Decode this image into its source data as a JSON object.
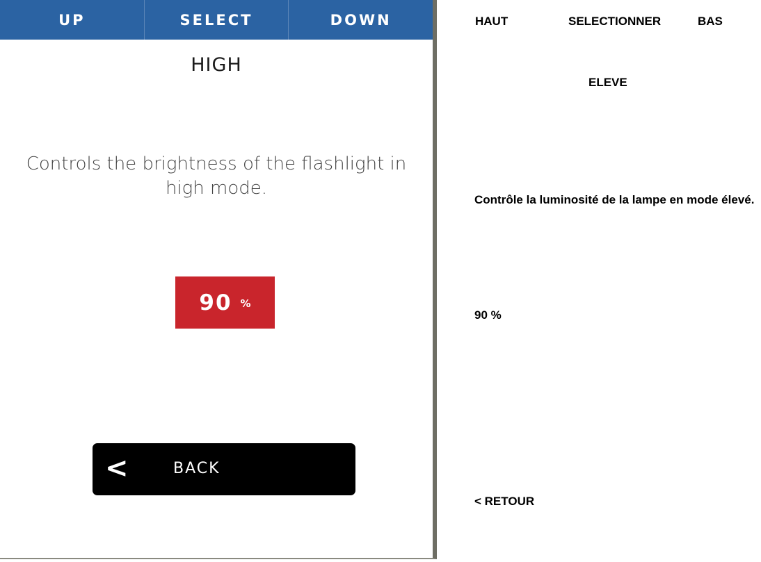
{
  "device": {
    "topbar": {
      "up_label": "UP",
      "select_label": "SELECT",
      "down_label": "DOWN"
    },
    "title": "HIGH",
    "description": "Controls the brightness of the flashlight in high mode.",
    "value": {
      "number": "90",
      "unit": "%"
    },
    "back": {
      "chevron": "<",
      "label": "BACK"
    }
  },
  "translation": {
    "up": "HAUT",
    "select": "SELECTIONNER",
    "down": "BAS",
    "title": "ELEVE",
    "description": "Contrôle la luminosité de la lampe en mode élevé.",
    "value": "90 %",
    "back": "< RETOUR"
  },
  "colors": {
    "topbar_blue": "#2b63a3",
    "value_red": "#c9252c",
    "back_black": "#000000"
  },
  "icons": {
    "back": "chevron-left-icon"
  }
}
